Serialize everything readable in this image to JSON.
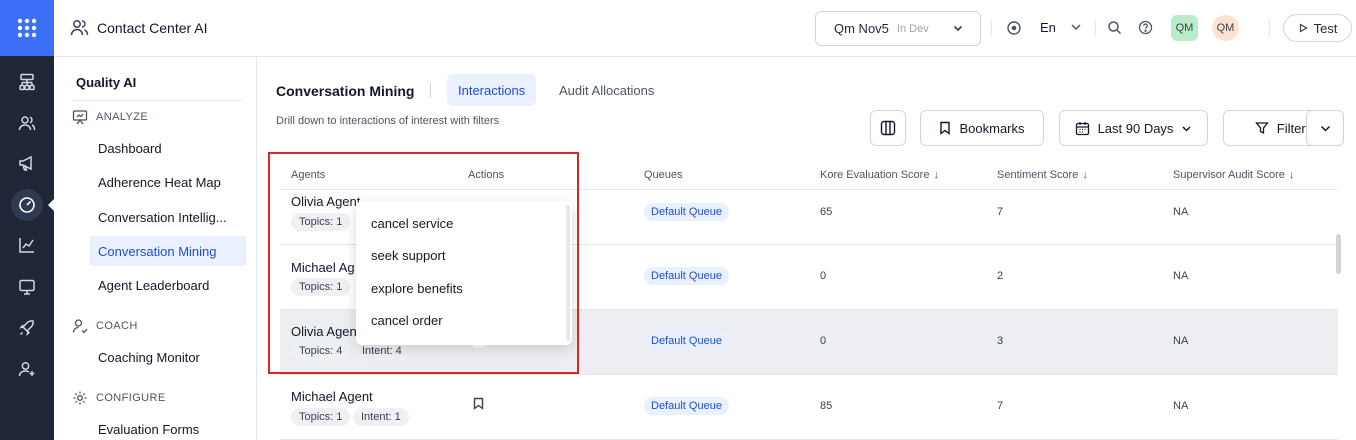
{
  "app": {
    "title": "Contact Center AI"
  },
  "env": {
    "name": "Qm Nov5",
    "status": "In Dev"
  },
  "header": {
    "language": "En",
    "avatar1": "QM",
    "avatar2": "QM",
    "test_label": "Test"
  },
  "sidebar": {
    "heading": "Quality AI",
    "sections": [
      {
        "label": "ANALYZE",
        "icon": "presentation-chart-icon",
        "items": [
          "Dashboard",
          "Adherence Heat Map",
          "Conversation Intellig...",
          "Conversation Mining",
          "Agent Leaderboard"
        ]
      },
      {
        "label": "COACH",
        "icon": "user-check-icon",
        "items": [
          "Coaching Monitor"
        ]
      },
      {
        "label": "CONFIGURE",
        "icon": "gear-icon",
        "items": [
          "Evaluation Forms"
        ]
      }
    ],
    "active_item": "Conversation Mining"
  },
  "main": {
    "title": "Conversation Mining",
    "tabs": [
      "Interactions",
      "Audit Allocations"
    ],
    "active_tab": "Interactions",
    "subtitle": "Drill down to interactions of interest with filters",
    "toolbar": {
      "bookmarks": "Bookmarks",
      "date_range": "Last 90 Days",
      "filters": "Filters"
    }
  },
  "table": {
    "columns": [
      "Agents",
      "Actions",
      "Queues",
      "Kore Evaluation Score",
      "Sentiment Score",
      "Supervisor Audit Score"
    ],
    "sort_indicator": "↓",
    "rows": [
      {
        "agent": "Olivia Agent",
        "topics": "Topics: 1",
        "intent": "",
        "queue": "Default Queue",
        "kore": "65",
        "sentiment": "7",
        "audit": "NA"
      },
      {
        "agent": "Michael Ag",
        "topics": "Topics: 1",
        "intent": "",
        "queue": "Default Queue",
        "kore": "0",
        "sentiment": "2",
        "audit": "NA"
      },
      {
        "agent": "Olivia Agen",
        "topics": "Topics: 4",
        "intent": "Intent: 4",
        "queue": "Default Queue",
        "kore": "0",
        "sentiment": "3",
        "audit": "NA"
      },
      {
        "agent": "Michael Agent",
        "topics": "Topics: 1",
        "intent": "Intent: 1",
        "queue": "Default Queue",
        "kore": "85",
        "sentiment": "7",
        "audit": "NA"
      }
    ]
  },
  "dropdown": {
    "options": [
      "cancel service",
      "seek support",
      "explore benefits",
      "cancel order"
    ]
  },
  "colors": {
    "accent": "#1d4ed8",
    "rail": "#1f2638",
    "logo": "#3b6ff5",
    "highlight_box": "#dc2626"
  }
}
